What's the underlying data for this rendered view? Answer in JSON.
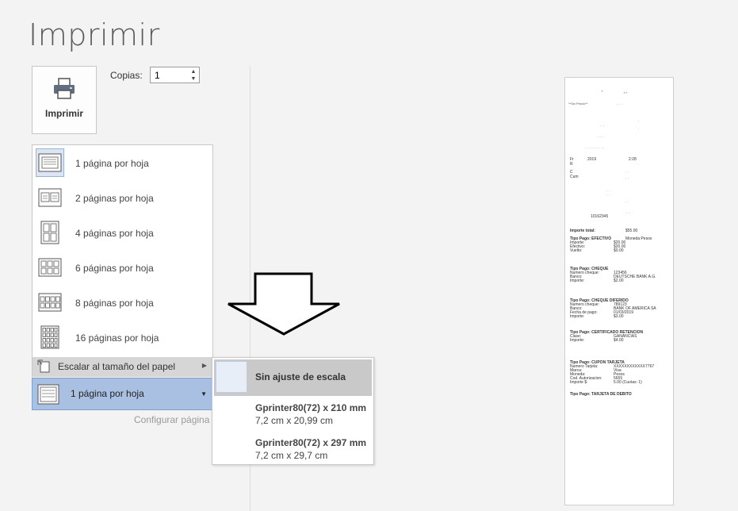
{
  "title": "Imprimir",
  "print_button": {
    "label": "Imprimir",
    "icon": "printer-icon"
  },
  "copies": {
    "label": "Copias:",
    "value": "1"
  },
  "pages_menu": {
    "items": [
      {
        "label": "1 página por hoja",
        "grid": [
          1,
          1
        ]
      },
      {
        "label": "2 páginas por hoja",
        "grid": [
          2,
          1
        ]
      },
      {
        "label": "4 páginas por hoja",
        "grid": [
          2,
          2
        ]
      },
      {
        "label": "6 páginas por hoja",
        "grid": [
          3,
          2
        ]
      },
      {
        "label": "8 páginas por hoja",
        "grid": [
          4,
          2
        ]
      },
      {
        "label": "16 páginas por hoja",
        "grid": [
          4,
          4
        ]
      }
    ],
    "scale_label": "Escalar al tamaño del papel"
  },
  "pages_dropdown": {
    "value": "1 página por hoja"
  },
  "page_setup_link": "Configurar página",
  "scale_submenu": [
    {
      "title": "Sin ajuste de escala",
      "subtitle": ""
    },
    {
      "title": "Gprinter80(72) x 210 mm",
      "subtitle": "7,2 cm x 20,99 cm"
    },
    {
      "title": "Gprinter80(72) x 297 mm",
      "subtitle": "7,2 cm x 29,7 cm"
    }
  ],
  "preview": {
    "lines": [
      {
        "t": "Importe total:",
        "v": "$55.00",
        "b": true
      },
      {
        "t": "Tipo Pago: EFECTIVO",
        "v": "Moneda:Pesos",
        "b": true
      },
      {
        "t": "Importe:",
        "v": "$20.00"
      },
      {
        "t": "Efectivo:",
        "v": "$20.00"
      },
      {
        "t": "Vuelto:",
        "v": "$0.00"
      },
      {
        "t": "Tipo Pago: CHEQUE",
        "v": "",
        "b": true
      },
      {
        "t": "Numero cheque:",
        "v": "123456"
      },
      {
        "t": "Banco:",
        "v": "DEUTSCHE BANK A.G."
      },
      {
        "t": "Importe:",
        "v": "$2.00"
      },
      {
        "t": "Tipo Pago: CHEQUE DIFERIDO",
        "v": "",
        "b": true
      },
      {
        "t": "Numero cheque:",
        "v": "789123"
      },
      {
        "t": "Banco:",
        "v": "BANK OF AMERICA SA"
      },
      {
        "t": "Fecha de pago:",
        "v": "01/03/2019"
      },
      {
        "t": "Importe:",
        "v": "$3.00"
      },
      {
        "t": "Tipo Pago: CERTIFICADO RETENCION",
        "v": "",
        "b": true
      },
      {
        "t": "Clase:",
        "v": "GANANCIAS"
      },
      {
        "t": "Importe:",
        "v": "$4.00"
      },
      {
        "t": "Tipo Pago: CUPON TARJETA",
        "v": "",
        "b": true
      },
      {
        "t": "Numero Tarjeta:",
        "v": "XXXXXXXXXXXX7767"
      },
      {
        "t": "Marca:",
        "v": "Visa"
      },
      {
        "t": "Moneda:",
        "v": "Pesos"
      },
      {
        "t": "Cod. Autorizacion:",
        "v": "5655"
      },
      {
        "t": "Importe $:",
        "v": "5.00 (Cuotas: 1)"
      },
      {
        "t": "Tipo Pago: TARJETA DE DEBITO",
        "v": "",
        "b": true
      }
    ],
    "header_fragments": [
      "**Sin Precio**",
      "Fr",
      "2019",
      "R",
      "2:28",
      "C",
      "Cum",
      "10162345"
    ]
  }
}
